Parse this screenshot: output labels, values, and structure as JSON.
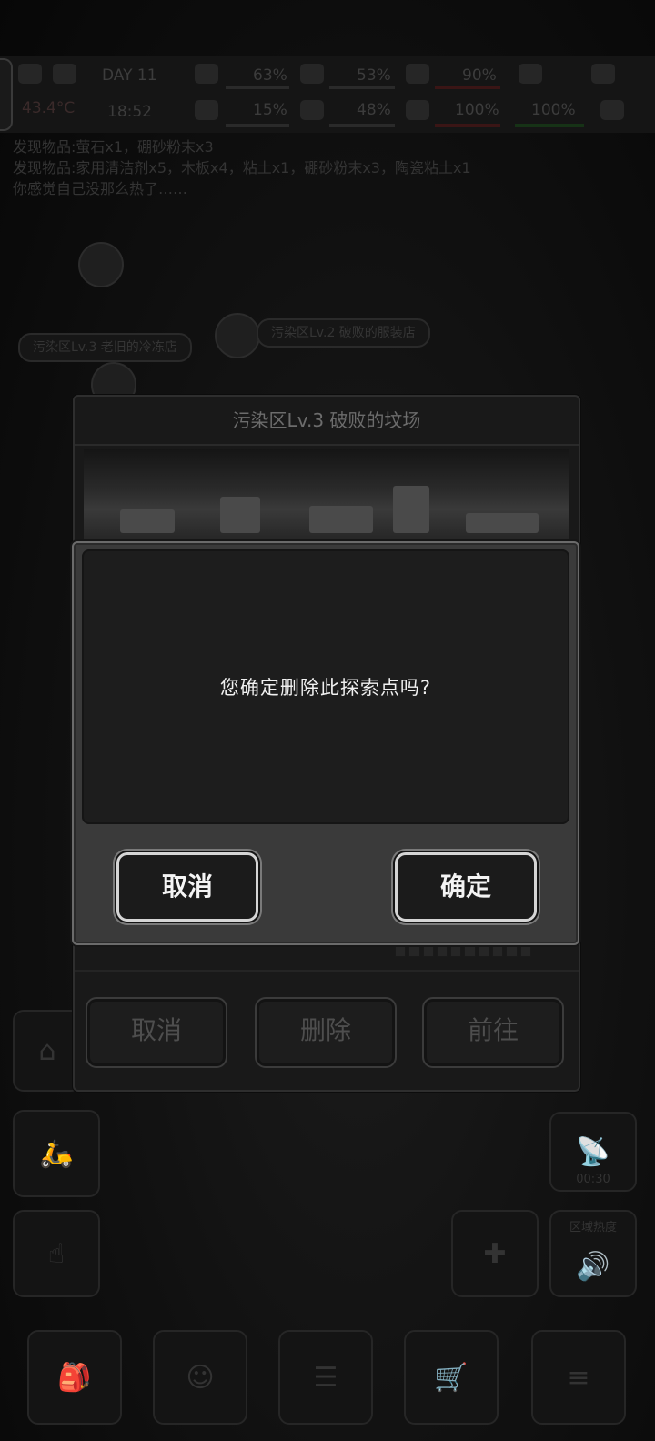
{
  "hud": {
    "row1": [
      "63%",
      "53%",
      "90%"
    ],
    "row2": [
      "43.4°C",
      "18:52",
      "15%",
      "48%",
      "100%",
      "100%"
    ],
    "day": "DAY 11"
  },
  "log_lines": [
    "发现物品:萤石x1，硼砂粉末x3",
    "发现物品:家用清洁剂x5，木板x4，粘土x1，硼砂粉末x3，陶瓷粘土x1",
    "你感觉自己没那么热了……"
  ],
  "map_labels": {
    "cold_store": "污染区Lv.3 老旧的冷冻店",
    "shop": "污染区Lv.2 破败的服装店"
  },
  "timer": "00:30",
  "area_heat": "区域热度",
  "location_panel": {
    "title": "污染区Lv.3 破败的坟场",
    "cancel": "取消",
    "delete": "删除",
    "goto": "前往"
  },
  "dialog": {
    "message": "您确定删除此探索点吗?",
    "cancel": "取消",
    "confirm": "确定"
  }
}
